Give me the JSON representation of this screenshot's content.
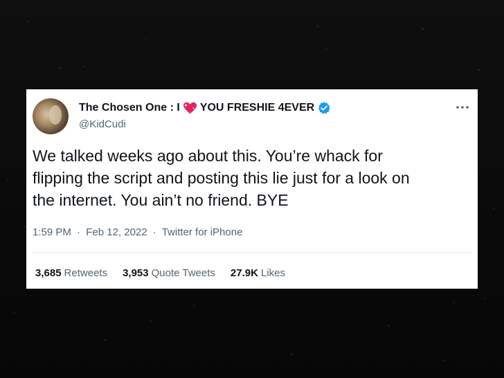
{
  "tweet": {
    "display_name_part1": "The Chosen One : I",
    "display_name_part2": "YOU FRESHIE 4EVER",
    "handle": "@KidCudi",
    "text_lines": [
      "We talked weeks ago about this. You’re whack for",
      "flipping the script and posting this lie just for a look on",
      "the internet. You ain’t no friend. BYE"
    ],
    "time": "1:59 PM",
    "date": "Feb 12, 2022",
    "source": "Twitter for iPhone",
    "separator": "·",
    "stats": [
      {
        "count": "3,685",
        "label": "Retweets"
      },
      {
        "count": "3,953",
        "label": "Quote Tweets"
      },
      {
        "count": "27.9K",
        "label": "Likes"
      }
    ]
  },
  "icons": {
    "heart": "sparkling-heart-icon",
    "verified": "verified-badge-icon",
    "more": "more-options-icon",
    "avatar": "avatar"
  },
  "colors": {
    "background": "#0b0b0b",
    "card": "#ffffff",
    "text_primary": "#0f1419",
    "text_secondary": "#536471",
    "verified_blue": "#1d9bf0",
    "heart_red": "#e0245e"
  }
}
